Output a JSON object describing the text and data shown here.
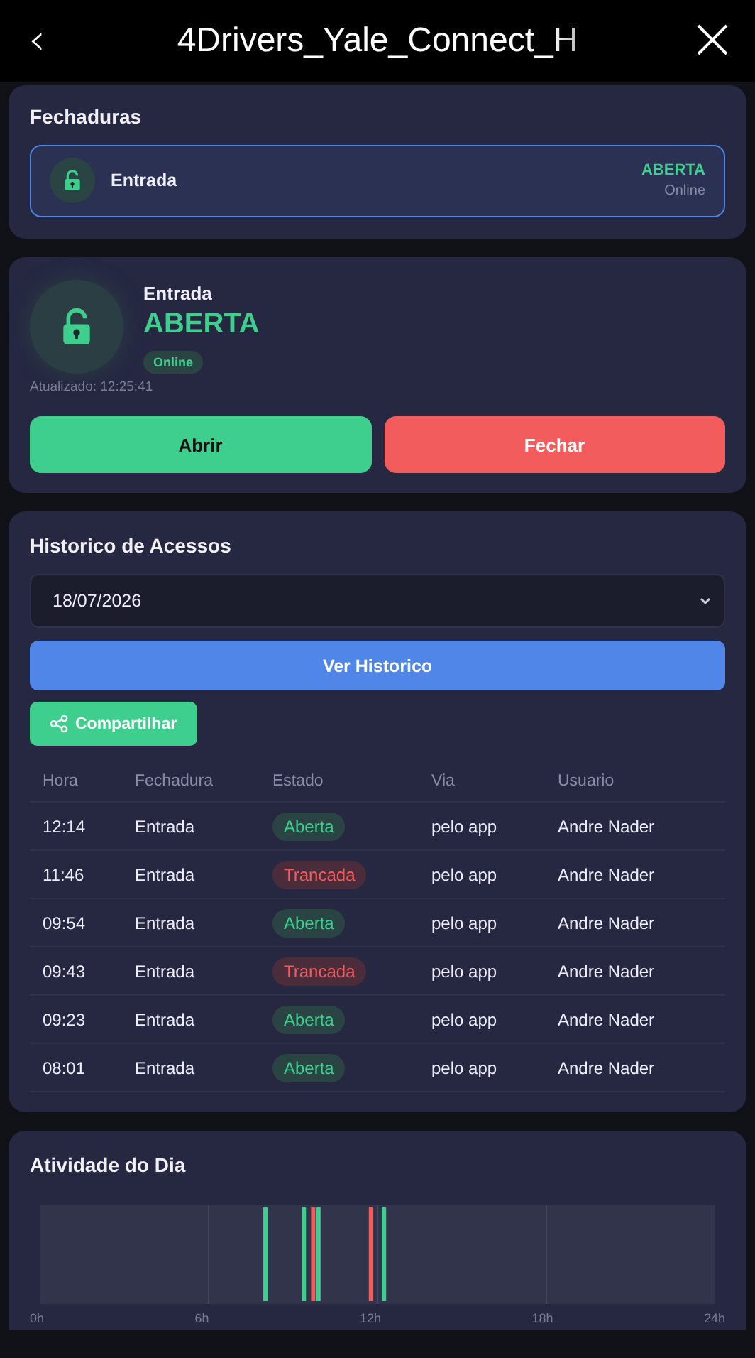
{
  "header": {
    "back": "‹",
    "title": "4Drivers_Yale_Connect_H"
  },
  "locks_card": {
    "title": "Fechaduras",
    "locks": [
      {
        "name": "Entrada",
        "status": "ABERTA",
        "connection": "Online",
        "selected": true,
        "locked": false
      }
    ]
  },
  "detail_card": {
    "name": "Entrada",
    "status": "ABERTA",
    "locked": false,
    "connection": "Online",
    "updated": "Atualizado: 12:25:41",
    "buttons": [
      {
        "label": "Abrir",
        "kind": "open"
      },
      {
        "label": "Fechar",
        "kind": "close"
      }
    ]
  },
  "history_card": {
    "title": "Historico de Acessos",
    "date": "18/07/2026",
    "view_button": "Ver Historico",
    "share_button": "Compartilhar",
    "columns": [
      "Hora",
      "Fechadura",
      "Estado",
      "Via",
      "Usuario"
    ],
    "rows": [
      {
        "time": "12:14",
        "lock": "Entrada",
        "state": "Aberta",
        "kind": "open",
        "via": "pelo app",
        "user": "Andre Nader"
      },
      {
        "time": "11:46",
        "lock": "Entrada",
        "state": "Trancada",
        "kind": "locked",
        "via": "pelo app",
        "user": "Andre Nader"
      },
      {
        "time": "09:54",
        "lock": "Entrada",
        "state": "Aberta",
        "kind": "open",
        "via": "pelo app",
        "user": "Andre Nader"
      },
      {
        "time": "09:43",
        "lock": "Entrada",
        "state": "Trancada",
        "kind": "locked",
        "via": "pelo app",
        "user": "Andre Nader"
      },
      {
        "time": "09:23",
        "lock": "Entrada",
        "state": "Aberta",
        "kind": "open",
        "via": "pelo app",
        "user": "Andre Nader"
      },
      {
        "time": "08:01",
        "lock": "Entrada",
        "state": "Aberta",
        "kind": "open",
        "via": "pelo app",
        "user": "Andre Nader"
      }
    ]
  },
  "activity_card": {
    "title": "Atividade do Dia",
    "axis_labels": [
      "0h",
      "6h",
      "12h",
      "18h",
      "24h"
    ]
  }
}
